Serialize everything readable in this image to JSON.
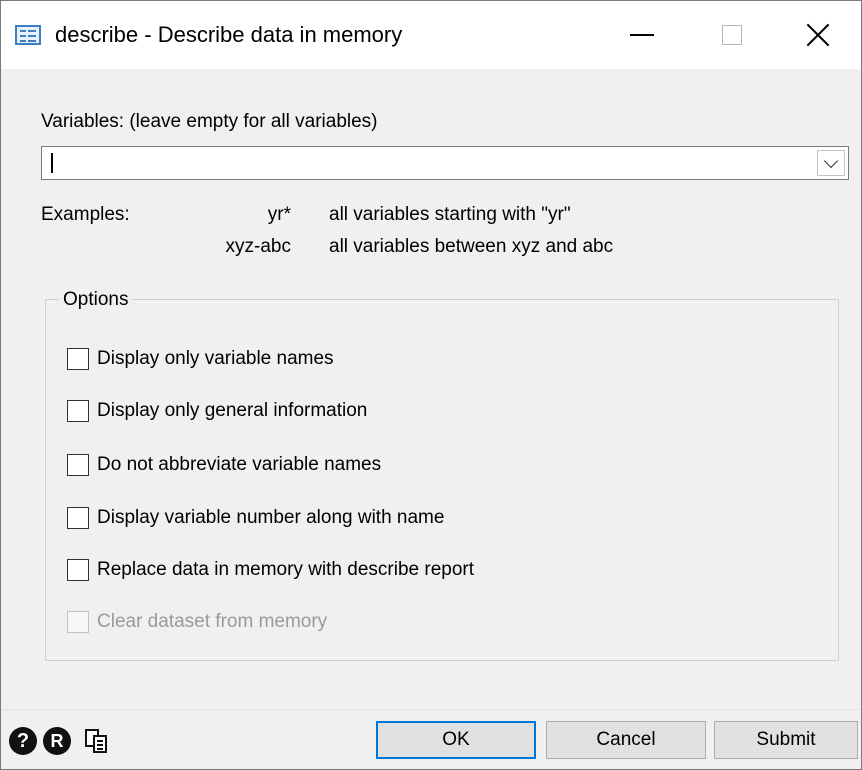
{
  "window": {
    "title": "describe - Describe data in memory"
  },
  "variables": {
    "label": "Variables: (leave empty for all variables)",
    "value": ""
  },
  "examples": {
    "label": "Examples:",
    "rows": [
      {
        "pattern": "yr*",
        "description": "all variables starting with \"yr\""
      },
      {
        "pattern": "xyz-abc",
        "description": "all variables between xyz and abc"
      }
    ]
  },
  "options": {
    "legend": "Options",
    "items": [
      {
        "label": "Display only variable names",
        "checked": false,
        "enabled": true
      },
      {
        "label": "Display only general information",
        "checked": false,
        "enabled": true
      },
      {
        "label": "Do not abbreviate variable names",
        "checked": false,
        "enabled": true
      },
      {
        "label": "Display variable number along with name",
        "checked": false,
        "enabled": true
      },
      {
        "label": "Replace data in memory with describe report",
        "checked": false,
        "enabled": true
      },
      {
        "label": "Clear dataset from memory",
        "checked": false,
        "enabled": false
      }
    ]
  },
  "footer": {
    "help_glyph": "?",
    "r_glyph": "R",
    "ok_label": "OK",
    "cancel_label": "Cancel",
    "submit_label": "Submit"
  },
  "colors": {
    "accent": "#0078d7",
    "icon_blue": "#3d7fc4",
    "disabled_text": "#9a9a9a"
  },
  "icons": {
    "app": "dialog-icon",
    "help": "help-icon",
    "reset": "r-badge-icon",
    "copy": "copy-command-icon"
  }
}
